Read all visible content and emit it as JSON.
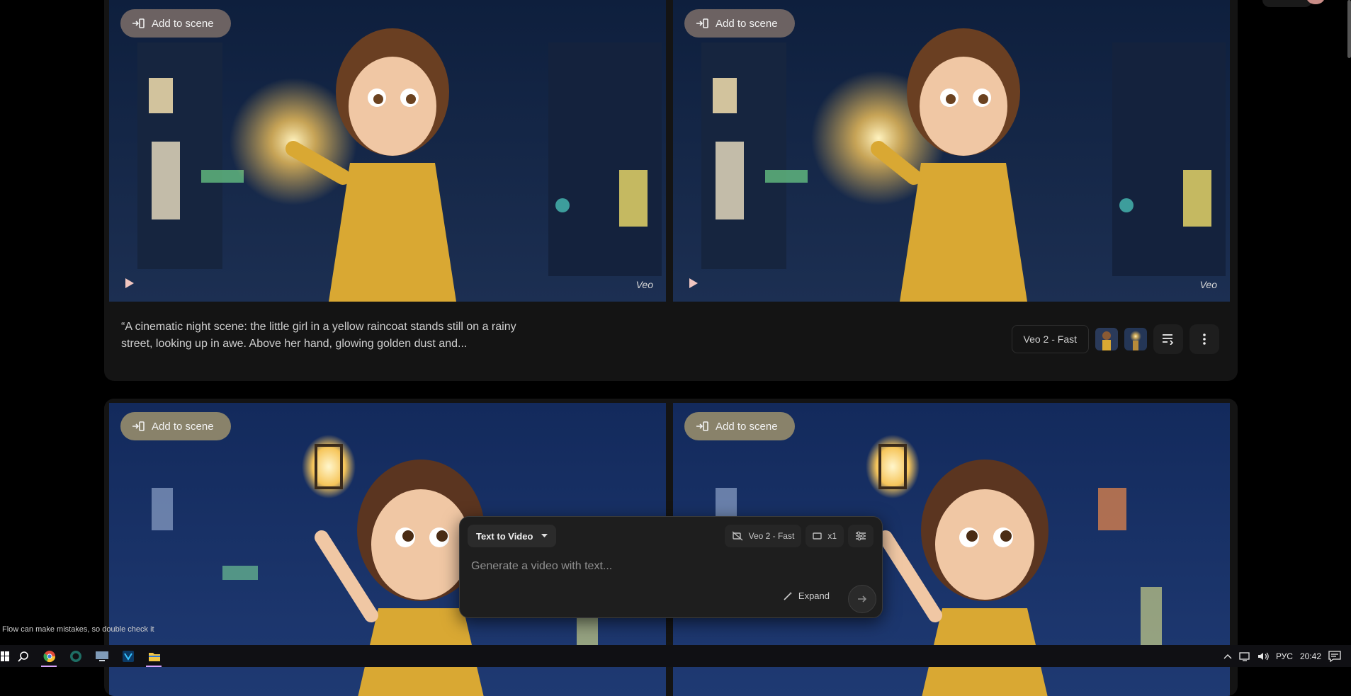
{
  "cards": [
    {
      "videos": [
        {
          "add_label": "Add to scene",
          "watermark": "Veo"
        },
        {
          "add_label": "Add to scene",
          "watermark": "Veo"
        }
      ],
      "caption": "“A cinematic night scene: the little girl in a yellow raincoat stands still on a rainy street, looking up in awe. Above her hand, glowing golden dust and...",
      "model": "Veo 2 - Fast"
    },
    {
      "videos": [
        {
          "add_label": "Add to scene"
        },
        {
          "add_label": "Add to scene"
        }
      ]
    }
  ],
  "prompt_bar": {
    "mode": "Text to Video",
    "model": "Veo 2 - Fast",
    "count": "x1",
    "placeholder": "Generate a video with text...",
    "expand_label": "Expand"
  },
  "disclaimer": "Flow can make mistakes, so double check it",
  "taskbar": {
    "lang": "РУС",
    "time": "20:42"
  },
  "colors": {
    "background": "#000000",
    "card": "#141414",
    "raincoat": "#d9a833",
    "night_blue": "#1b3460"
  }
}
